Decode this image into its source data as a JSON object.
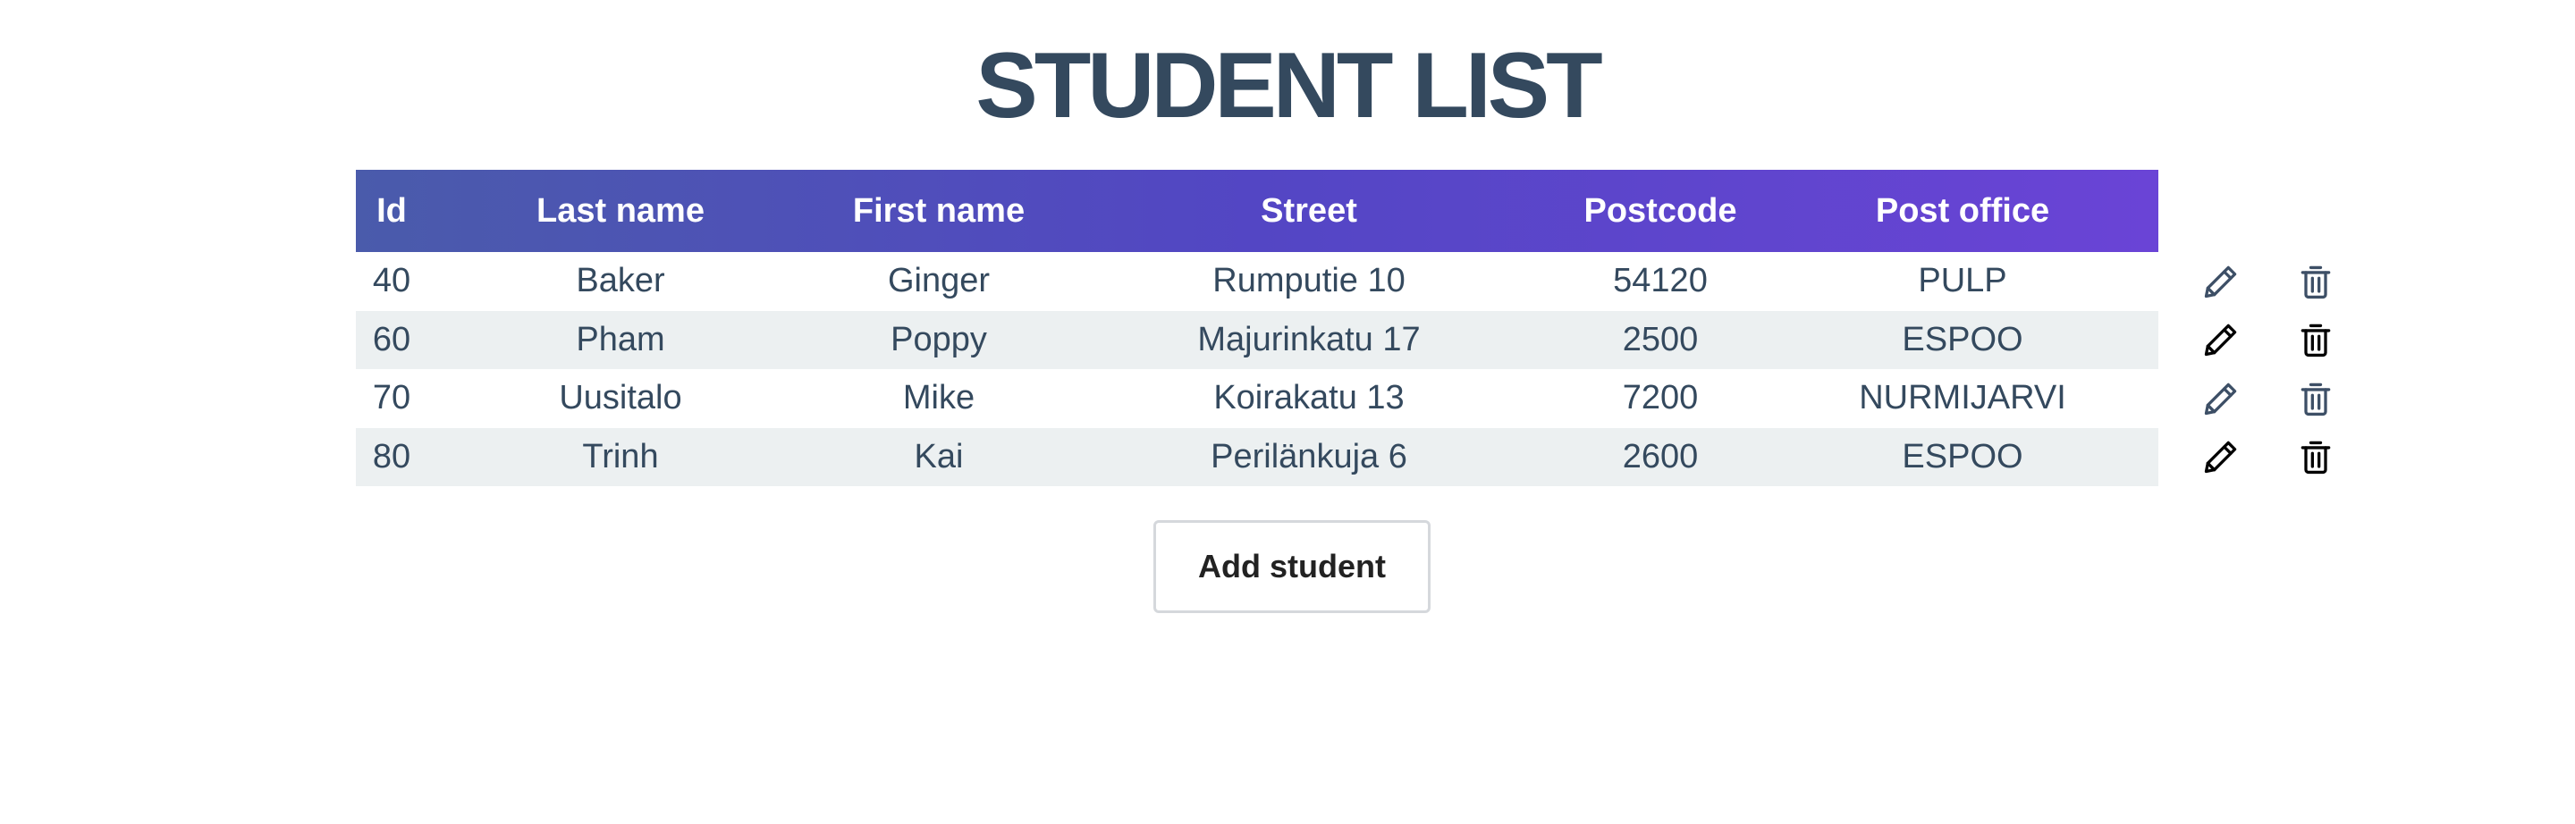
{
  "page": {
    "title": "STUDENT LIST"
  },
  "table": {
    "headers": [
      "Id",
      "Last name",
      "First name",
      "Street",
      "Postcode",
      "Post office"
    ],
    "header_gradient": [
      "#4a5bab",
      "#5346c4",
      "#6a44d6"
    ],
    "rows": [
      {
        "id": "40",
        "last_name": "Baker",
        "first_name": "Ginger",
        "street": "Rumputie 10",
        "postcode": "54120",
        "post_office": "PULP"
      },
      {
        "id": "60",
        "last_name": "Pham",
        "first_name": "Poppy",
        "street": "Majurinkatu 17",
        "postcode": "2500",
        "post_office": "ESPOO"
      },
      {
        "id": "70",
        "last_name": "Uusitalo",
        "first_name": "Mike",
        "street": "Koirakatu 13",
        "postcode": "7200",
        "post_office": "NURMIJARVI"
      },
      {
        "id": "80",
        "last_name": "Trinh",
        "first_name": "Kai",
        "street": "Perilänkuja 6",
        "postcode": "2600",
        "post_office": "ESPOO"
      }
    ]
  },
  "row_actions": {
    "edit_icon": "pencil-icon",
    "delete_icon": "trash-icon",
    "icon_colors": [
      "#3d4f66",
      "#000000",
      "#3d4f66",
      "#000000"
    ]
  },
  "add_button": {
    "label": "Add student"
  },
  "colors": {
    "title": "#34495e",
    "text": "#34495e",
    "stripe": "#ecf0f1"
  }
}
